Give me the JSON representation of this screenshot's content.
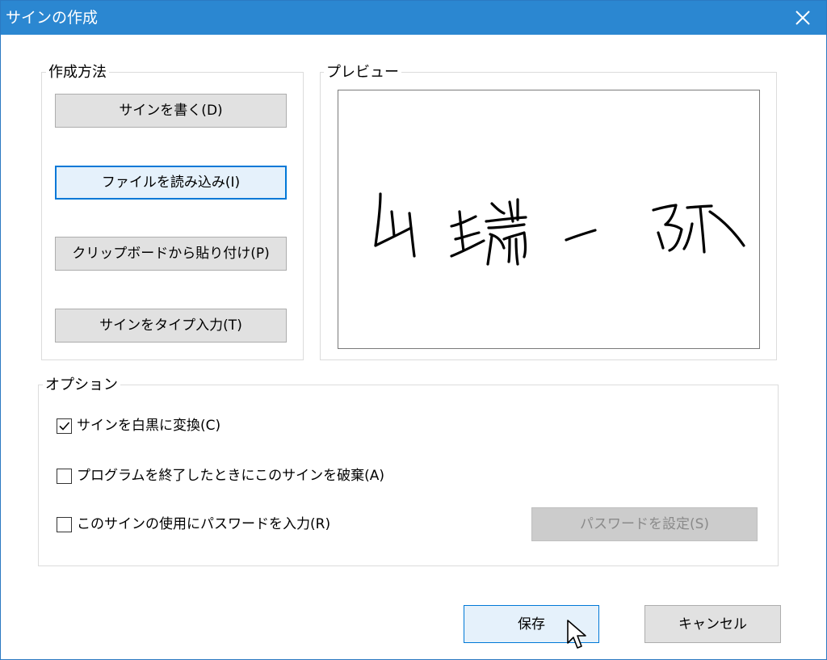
{
  "window": {
    "title": "サインの作成",
    "close_icon": "close-icon",
    "titlebar_color": "#2b87d1"
  },
  "method_group": {
    "legend": "作成方法",
    "buttons": [
      {
        "label": "サインを書く(D)"
      },
      {
        "label": "ファイルを読み込み(I)",
        "focused": true
      },
      {
        "label": "クリップボードから貼り付け(P)"
      },
      {
        "label": "サインをタイプ入力(T)"
      }
    ]
  },
  "preview_group": {
    "legend": "プレビュー",
    "signature_image": "handwritten-signature",
    "signature_text": "山端一弥"
  },
  "options_group": {
    "legend": "オプション",
    "checkboxes": [
      {
        "label": "サインを白黒に変換(C)",
        "checked": true
      },
      {
        "label": "プログラムを終了したときにこのサインを破棄(A)",
        "checked": false
      },
      {
        "label": "このサインの使用にパスワードを入力(R)",
        "checked": false
      }
    ],
    "set_password_button": {
      "label": "パスワードを設定(S)",
      "disabled": true
    }
  },
  "footer": {
    "save_label": "保存",
    "cancel_label": "キャンセル"
  },
  "accent_color": "#0078d7"
}
